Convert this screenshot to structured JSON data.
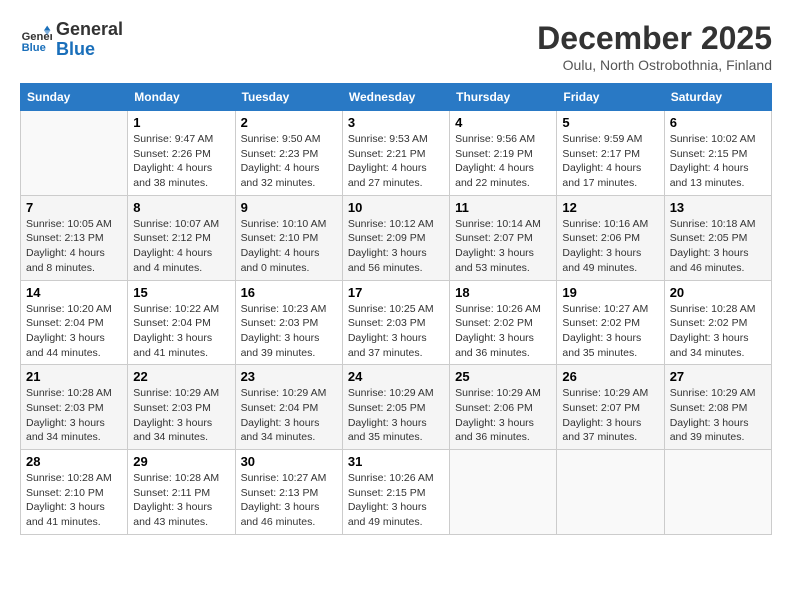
{
  "header": {
    "logo_line1": "General",
    "logo_line2": "Blue",
    "month": "December 2025",
    "location": "Oulu, North Ostrobothnia, Finland"
  },
  "weekdays": [
    "Sunday",
    "Monday",
    "Tuesday",
    "Wednesday",
    "Thursday",
    "Friday",
    "Saturday"
  ],
  "weeks": [
    [
      {
        "day": "",
        "info": ""
      },
      {
        "day": "1",
        "info": "Sunrise: 9:47 AM\nSunset: 2:26 PM\nDaylight: 4 hours\nand 38 minutes."
      },
      {
        "day": "2",
        "info": "Sunrise: 9:50 AM\nSunset: 2:23 PM\nDaylight: 4 hours\nand 32 minutes."
      },
      {
        "day": "3",
        "info": "Sunrise: 9:53 AM\nSunset: 2:21 PM\nDaylight: 4 hours\nand 27 minutes."
      },
      {
        "day": "4",
        "info": "Sunrise: 9:56 AM\nSunset: 2:19 PM\nDaylight: 4 hours\nand 22 minutes."
      },
      {
        "day": "5",
        "info": "Sunrise: 9:59 AM\nSunset: 2:17 PM\nDaylight: 4 hours\nand 17 minutes."
      },
      {
        "day": "6",
        "info": "Sunrise: 10:02 AM\nSunset: 2:15 PM\nDaylight: 4 hours\nand 13 minutes."
      }
    ],
    [
      {
        "day": "7",
        "info": "Sunrise: 10:05 AM\nSunset: 2:13 PM\nDaylight: 4 hours\nand 8 minutes."
      },
      {
        "day": "8",
        "info": "Sunrise: 10:07 AM\nSunset: 2:12 PM\nDaylight: 4 hours\nand 4 minutes."
      },
      {
        "day": "9",
        "info": "Sunrise: 10:10 AM\nSunset: 2:10 PM\nDaylight: 4 hours\nand 0 minutes."
      },
      {
        "day": "10",
        "info": "Sunrise: 10:12 AM\nSunset: 2:09 PM\nDaylight: 3 hours\nand 56 minutes."
      },
      {
        "day": "11",
        "info": "Sunrise: 10:14 AM\nSunset: 2:07 PM\nDaylight: 3 hours\nand 53 minutes."
      },
      {
        "day": "12",
        "info": "Sunrise: 10:16 AM\nSunset: 2:06 PM\nDaylight: 3 hours\nand 49 minutes."
      },
      {
        "day": "13",
        "info": "Sunrise: 10:18 AM\nSunset: 2:05 PM\nDaylight: 3 hours\nand 46 minutes."
      }
    ],
    [
      {
        "day": "14",
        "info": "Sunrise: 10:20 AM\nSunset: 2:04 PM\nDaylight: 3 hours\nand 44 minutes."
      },
      {
        "day": "15",
        "info": "Sunrise: 10:22 AM\nSunset: 2:04 PM\nDaylight: 3 hours\nand 41 minutes."
      },
      {
        "day": "16",
        "info": "Sunrise: 10:23 AM\nSunset: 2:03 PM\nDaylight: 3 hours\nand 39 minutes."
      },
      {
        "day": "17",
        "info": "Sunrise: 10:25 AM\nSunset: 2:03 PM\nDaylight: 3 hours\nand 37 minutes."
      },
      {
        "day": "18",
        "info": "Sunrise: 10:26 AM\nSunset: 2:02 PM\nDaylight: 3 hours\nand 36 minutes."
      },
      {
        "day": "19",
        "info": "Sunrise: 10:27 AM\nSunset: 2:02 PM\nDaylight: 3 hours\nand 35 minutes."
      },
      {
        "day": "20",
        "info": "Sunrise: 10:28 AM\nSunset: 2:02 PM\nDaylight: 3 hours\nand 34 minutes."
      }
    ],
    [
      {
        "day": "21",
        "info": "Sunrise: 10:28 AM\nSunset: 2:03 PM\nDaylight: 3 hours\nand 34 minutes."
      },
      {
        "day": "22",
        "info": "Sunrise: 10:29 AM\nSunset: 2:03 PM\nDaylight: 3 hours\nand 34 minutes."
      },
      {
        "day": "23",
        "info": "Sunrise: 10:29 AM\nSunset: 2:04 PM\nDaylight: 3 hours\nand 34 minutes."
      },
      {
        "day": "24",
        "info": "Sunrise: 10:29 AM\nSunset: 2:05 PM\nDaylight: 3 hours\nand 35 minutes."
      },
      {
        "day": "25",
        "info": "Sunrise: 10:29 AM\nSunset: 2:06 PM\nDaylight: 3 hours\nand 36 minutes."
      },
      {
        "day": "26",
        "info": "Sunrise: 10:29 AM\nSunset: 2:07 PM\nDaylight: 3 hours\nand 37 minutes."
      },
      {
        "day": "27",
        "info": "Sunrise: 10:29 AM\nSunset: 2:08 PM\nDaylight: 3 hours\nand 39 minutes."
      }
    ],
    [
      {
        "day": "28",
        "info": "Sunrise: 10:28 AM\nSunset: 2:10 PM\nDaylight: 3 hours\nand 41 minutes."
      },
      {
        "day": "29",
        "info": "Sunrise: 10:28 AM\nSunset: 2:11 PM\nDaylight: 3 hours\nand 43 minutes."
      },
      {
        "day": "30",
        "info": "Sunrise: 10:27 AM\nSunset: 2:13 PM\nDaylight: 3 hours\nand 46 minutes."
      },
      {
        "day": "31",
        "info": "Sunrise: 10:26 AM\nSunset: 2:15 PM\nDaylight: 3 hours\nand 49 minutes."
      },
      {
        "day": "",
        "info": ""
      },
      {
        "day": "",
        "info": ""
      },
      {
        "day": "",
        "info": ""
      }
    ]
  ]
}
